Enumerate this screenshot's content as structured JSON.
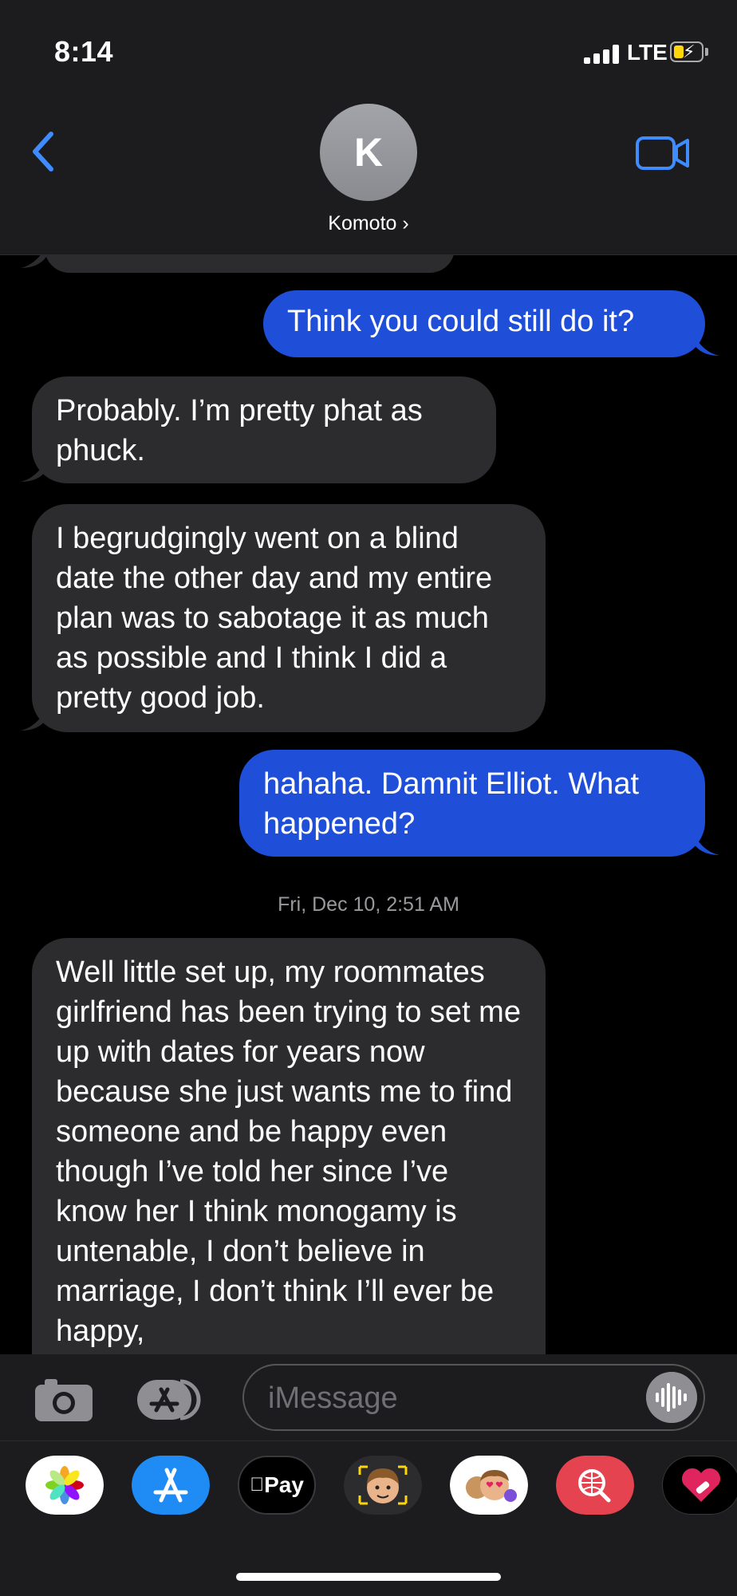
{
  "status_bar": {
    "time": "8:14",
    "network": "LTE"
  },
  "header": {
    "avatar_initial": "K",
    "contact_name": "Komoto ›"
  },
  "messages": [
    {
      "from": "me",
      "text": "Think you could still do it?"
    },
    {
      "from": "them",
      "text": "Probably. I’m pretty phat as phuck."
    },
    {
      "from": "them",
      "text": "I begrudgingly went on a blind date the other day and my entire plan was to sabotage it as much as possible and I think I did a pretty good job."
    },
    {
      "from": "me",
      "text": "hahaha. Damnit Elliot. What happened?"
    },
    {
      "from": "them",
      "text": "Well little set up, my roommates girlfriend has been trying to set me up with dates for years now because she just wants me to find someone and be happy even though I’ve told her since I’ve know her I think monogamy is untenable, I don’t believe in marriage, I don’t think I’ll ever be happy,"
    }
  ],
  "timestamp": "Fri, Dec 10, 2:51 AM",
  "input": {
    "placeholder": "iMessage"
  },
  "app_drawer": {
    "items": [
      "photos-app-icon",
      "app-store-icon",
      "apple-pay-icon",
      "memoji-camera-icon",
      "memoji-stickers-icon",
      "image-search-icon",
      "heart-app-icon"
    ],
    "apple_pay_label": "Pay"
  },
  "colors": {
    "sent_bubble": "#1f4fd8",
    "received_bubble": "#2c2c2e",
    "accent_blue": "#3f8cff"
  }
}
